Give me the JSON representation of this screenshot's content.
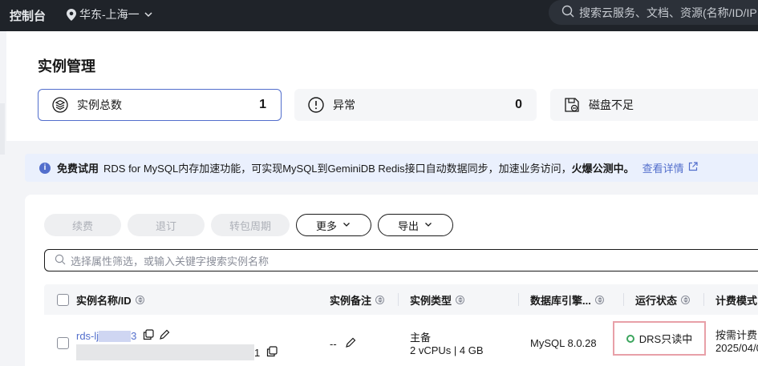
{
  "topbar": {
    "brand": "控制台",
    "region": "华东-上海一",
    "search_placeholder": "搜索云服务、文档、资源(名称/ID/IP"
  },
  "page": {
    "title": "实例管理"
  },
  "stats": [
    {
      "label": "实例总数",
      "count": "1",
      "icon": "layers-icon"
    },
    {
      "label": "异常",
      "count": "0",
      "icon": "alert-circle-icon"
    },
    {
      "label": "磁盘不足",
      "count": "",
      "icon": "disk-save-icon"
    }
  ],
  "notice": {
    "tag": "免费试用",
    "text": "RDS for MySQL内存加速功能，可实现MySQL到GeminiDB Redis接口自动数据同步，加速业务访问，",
    "hot": "火爆公测中。",
    "link": "查看详情"
  },
  "toolbar": {
    "renew": "续费",
    "unsubscribe": "退订",
    "to_yearly": "转包周期",
    "more": "更多",
    "export": "导出"
  },
  "filter": {
    "placeholder": "选择属性筛选，或输入关键字搜索实例名称"
  },
  "table": {
    "columns": [
      "实例名称/ID",
      "实例备注",
      "实例类型",
      "数据库引擎...",
      "运行状态",
      "计费模式"
    ],
    "rows": [
      {
        "name_prefix": "rds-lj",
        "name_suffix": "3",
        "id_suffix": "1",
        "remark": "--",
        "type_main": "主备",
        "type_spec": "2 vCPUs | 4 GB",
        "engine": "MySQL 8.0.28",
        "status": "DRS只读中",
        "billing": "按需计费",
        "billing_date": "2025/04/0"
      }
    ]
  },
  "colors": {
    "topbar": "#1f2329",
    "accent": "#526ecc",
    "status_ok": "#3ba55d",
    "highlight_border": "#e8a0a8"
  }
}
